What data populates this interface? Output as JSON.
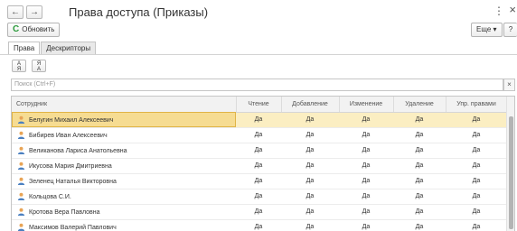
{
  "header": {
    "title": "Права доступа (Приказы)",
    "back_icon": "←",
    "forward_icon": "→",
    "more_icon": "⋮",
    "close_icon": "×"
  },
  "toolbar": {
    "refresh_label": "Обновить",
    "refresh_icon": "C",
    "more_label": "Еще ▾",
    "help_label": "?"
  },
  "tabs": [
    {
      "label": "Права",
      "active": true
    },
    {
      "label": "Дескрипторы",
      "active": false
    }
  ],
  "sort_buttons": {
    "ascending_glyph": "А\nЯ",
    "descending_glyph": "Я\nА"
  },
  "search": {
    "placeholder": "Поиск (Ctrl+F)",
    "clear_label": "×"
  },
  "table": {
    "columns": [
      "Сотрудник",
      "Чтение",
      "Добавление",
      "Изменение",
      "Удаление",
      "Упр. правами"
    ],
    "rows": [
      {
        "name": "Белугин Михаил Алексеевич",
        "values": [
          "Да",
          "Да",
          "Да",
          "Да",
          "Да"
        ],
        "selected": true
      },
      {
        "name": "Бибирев Иван Алексеевич",
        "values": [
          "Да",
          "Да",
          "Да",
          "Да",
          "Да"
        ]
      },
      {
        "name": "Великанова Лариса Анатольевна",
        "values": [
          "Да",
          "Да",
          "Да",
          "Да",
          "Да"
        ]
      },
      {
        "name": "Икусова Мария Дмитриевна",
        "values": [
          "Да",
          "Да",
          "Да",
          "Да",
          "Да"
        ]
      },
      {
        "name": "Зеленец Наталья Викторовна",
        "values": [
          "Да",
          "Да",
          "Да",
          "Да",
          "Да"
        ]
      },
      {
        "name": "Кольцова С.И.",
        "values": [
          "Да",
          "Да",
          "Да",
          "Да",
          "Да"
        ]
      },
      {
        "name": "Кротова Вера Павловна",
        "values": [
          "Да",
          "Да",
          "Да",
          "Да",
          "Да"
        ]
      },
      {
        "name": "Максимов Валерий Павлович",
        "values": [
          "Да",
          "Да",
          "Да",
          "Да",
          "Да"
        ]
      }
    ]
  },
  "colors": {
    "selected_row": "#fbeec2",
    "selected_cell": "#f6dc92",
    "refresh_icon": "#2a9a3a"
  }
}
